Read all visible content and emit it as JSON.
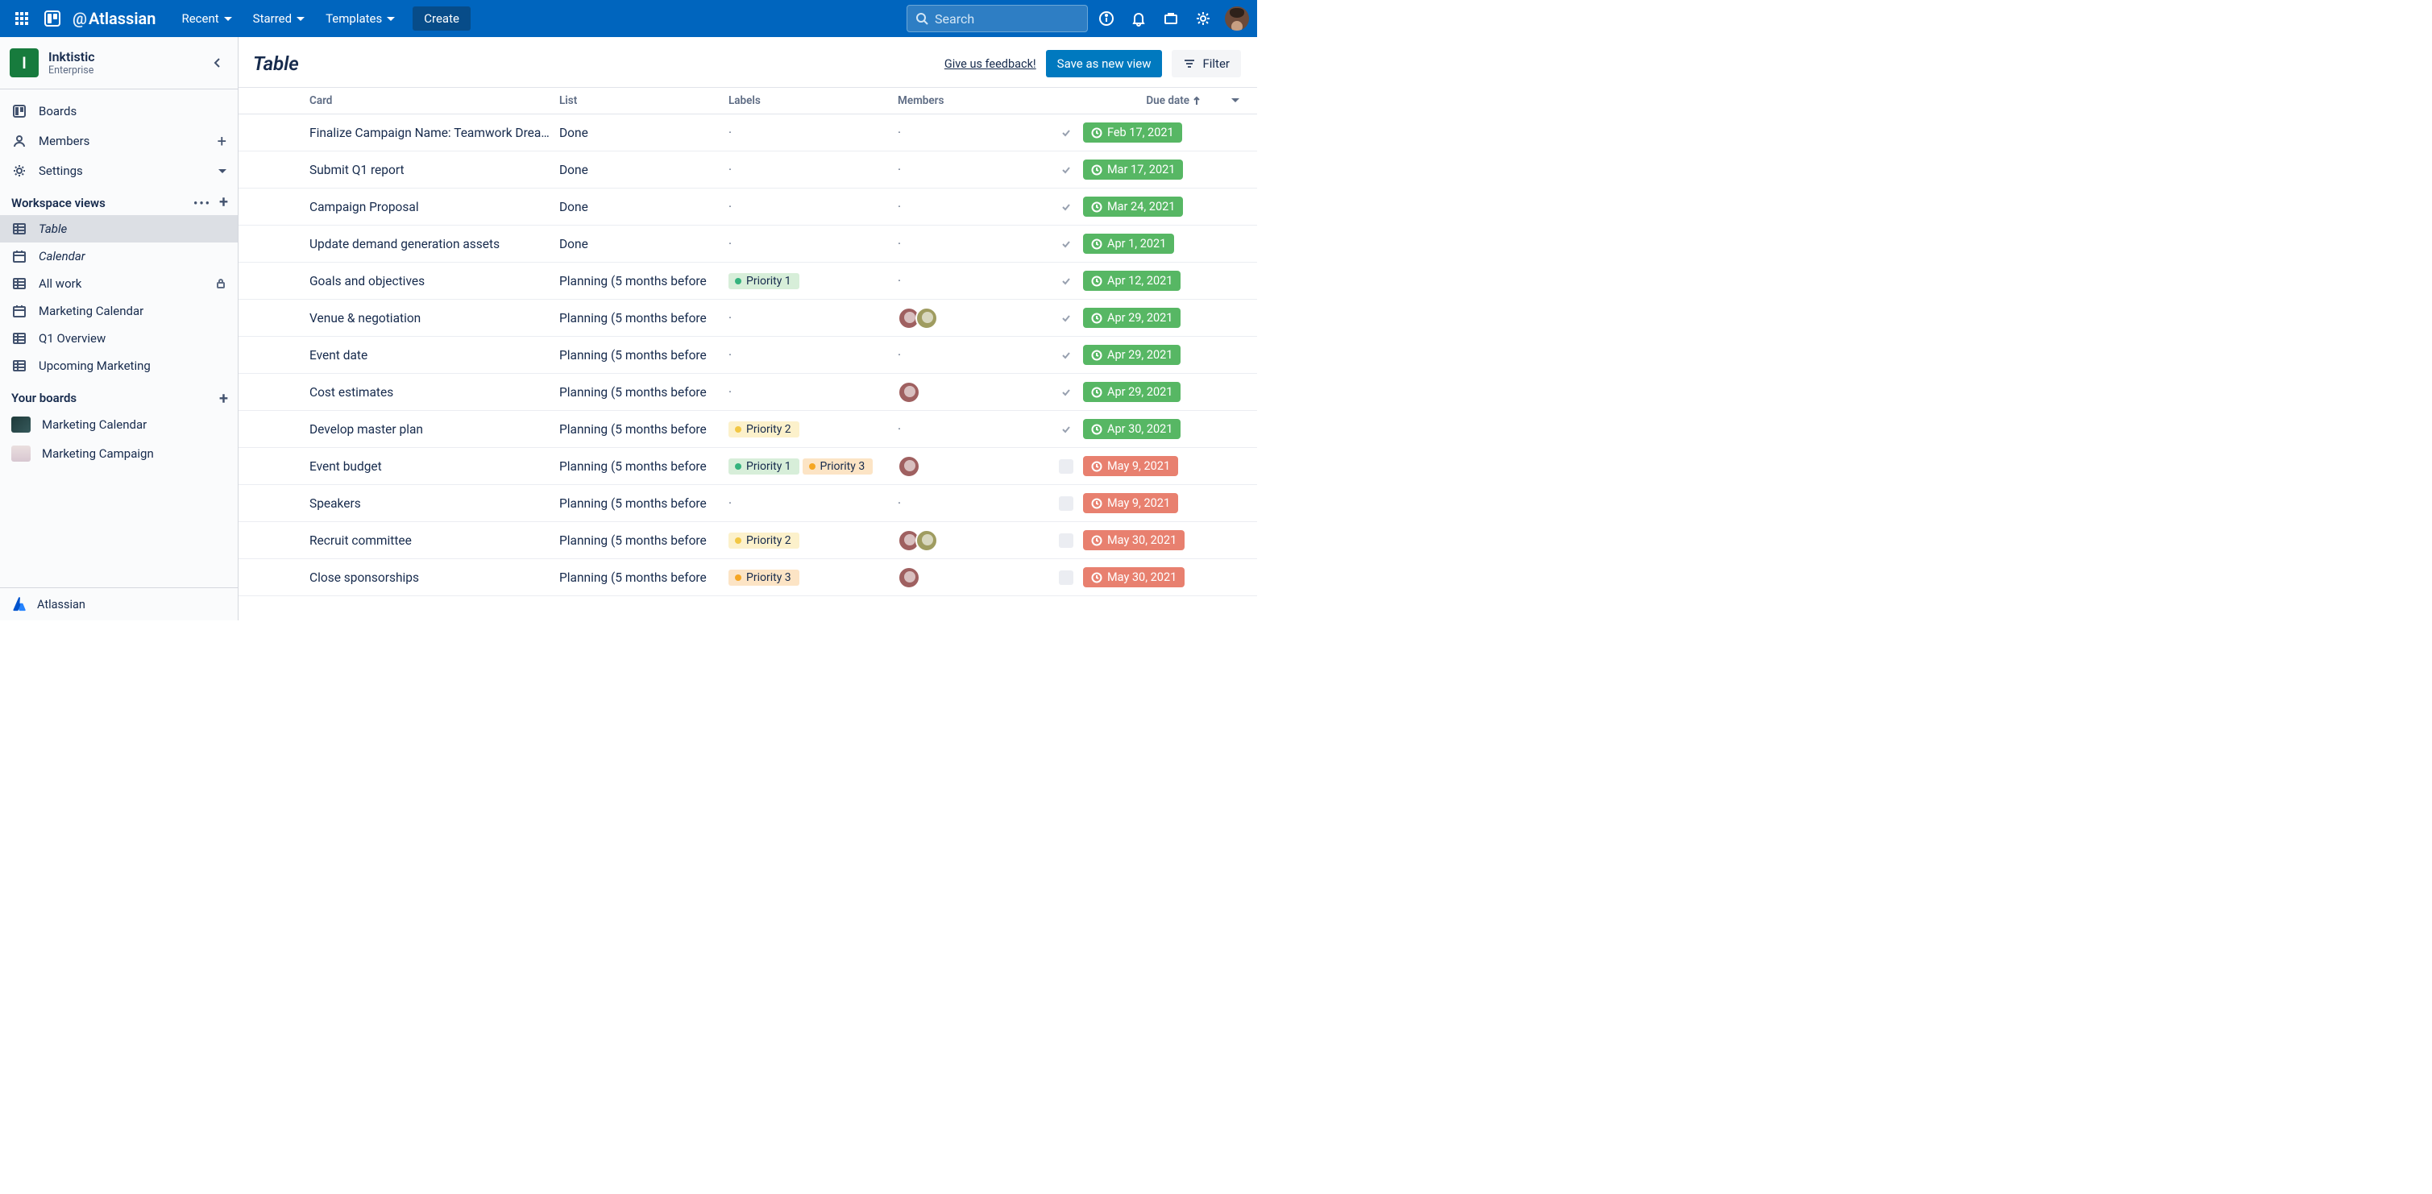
{
  "topnav": {
    "brand": "Atlassian",
    "menus": [
      "Recent",
      "Starred",
      "Templates"
    ],
    "create": "Create",
    "search_placeholder": "Search"
  },
  "workspace": {
    "initial": "I",
    "name": "Inktistic",
    "plan": "Enterprise"
  },
  "sidenav": {
    "primary": [
      {
        "icon": "board",
        "label": "Boards"
      },
      {
        "icon": "members",
        "label": "Members",
        "trailing": "plus"
      },
      {
        "icon": "gear",
        "label": "Settings",
        "trailing": "caret"
      }
    ],
    "views_header": "Workspace views",
    "views": [
      {
        "icon": "table",
        "label": "Table",
        "italic": true,
        "active": true
      },
      {
        "icon": "calendar",
        "label": "Calendar",
        "italic": true
      },
      {
        "icon": "table",
        "label": "All work",
        "lock": true
      },
      {
        "icon": "calendar",
        "label": "Marketing Calendar"
      },
      {
        "icon": "table",
        "label": "Q1 Overview"
      },
      {
        "icon": "table",
        "label": "Upcoming Marketing"
      }
    ],
    "boards_header": "Your boards",
    "boards": [
      {
        "label": "Marketing Calendar",
        "thumb": "dark"
      },
      {
        "label": "Marketing Campaign",
        "thumb": "pale"
      }
    ],
    "footer": "Atlassian"
  },
  "main": {
    "title": "Table",
    "feedback": "Give us feedback!",
    "save": "Save as new view",
    "filter": "Filter"
  },
  "columns": {
    "card": "Card",
    "list": "List",
    "labels": "Labels",
    "members": "Members",
    "due": "Due date"
  },
  "label_text": {
    "p1": "Priority 1",
    "p2": "Priority 2",
    "p3": "Priority 3"
  },
  "rows": [
    {
      "cover": "teal",
      "title": "Finalize Campaign Name: Teamwork Dream W",
      "list": "Done",
      "labels": [],
      "members": 0,
      "due": "Feb 17, 2021",
      "due_color": "green",
      "done": true
    },
    {
      "cover": "teal",
      "title": "Submit Q1 report",
      "list": "Done",
      "labels": [],
      "members": 0,
      "due": "Mar 17, 2021",
      "due_color": "green",
      "done": true
    },
    {
      "cover": "teal",
      "title": "Campaign Proposal",
      "list": "Done",
      "labels": [],
      "members": 0,
      "due": "Mar 24, 2021",
      "due_color": "green",
      "done": true
    },
    {
      "cover": "pink",
      "title": "Update demand generation assets",
      "list": "Done",
      "labels": [],
      "members": 0,
      "due": "Apr 1, 2021",
      "due_color": "green",
      "done": true
    },
    {
      "cover": "texture",
      "title": "Goals and objectives",
      "list": "Planning (5 months before",
      "labels": [
        "p1"
      ],
      "members": 0,
      "due": "Apr 12, 2021",
      "due_color": "green",
      "done": true
    },
    {
      "cover": "texture",
      "title": "Venue & negotiation",
      "list": "Planning (5 months before",
      "labels": [],
      "members": 2,
      "due": "Apr 29, 2021",
      "due_color": "green",
      "done": true
    },
    {
      "cover": "texture",
      "title": "Event date",
      "list": "Planning (5 months before",
      "labels": [],
      "members": 0,
      "due": "Apr 29, 2021",
      "due_color": "green",
      "done": true
    },
    {
      "cover": "texture",
      "title": "Cost estimates",
      "list": "Planning (5 months before",
      "labels": [],
      "members": 1,
      "due": "Apr 29, 2021",
      "due_color": "green",
      "done": true
    },
    {
      "cover": "texture",
      "title": "Develop master plan",
      "list": "Planning (5 months before",
      "labels": [
        "p2"
      ],
      "members": 0,
      "due": "Apr 30, 2021",
      "due_color": "green",
      "done": true
    },
    {
      "cover": "texture",
      "title": "Event budget",
      "list": "Planning (5 months before",
      "labels": [
        "p1",
        "p3"
      ],
      "members": 1,
      "due": "May 9, 2021",
      "due_color": "red",
      "done": false
    },
    {
      "cover": "texture",
      "title": "Speakers",
      "list": "Planning (5 months before",
      "labels": [],
      "members": 0,
      "due": "May 9, 2021",
      "due_color": "red",
      "done": false
    },
    {
      "cover": "texture",
      "title": "Recruit committee",
      "list": "Planning (5 months before",
      "labels": [
        "p2"
      ],
      "members": 2,
      "due": "May 30, 2021",
      "due_color": "red",
      "done": false
    },
    {
      "cover": "texture",
      "title": "Close sponsorships",
      "list": "Planning (5 months before",
      "labels": [
        "p3"
      ],
      "members": 1,
      "due": "May 30, 2021",
      "due_color": "red",
      "done": false
    }
  ]
}
